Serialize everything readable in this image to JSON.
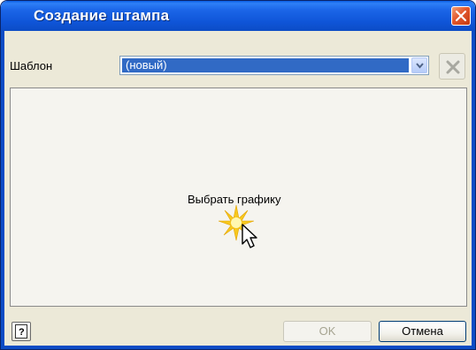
{
  "window": {
    "title": "Создание штампа",
    "close_icon": "close-icon"
  },
  "template": {
    "label": "Шаблон",
    "selected": "(новый)",
    "dropdown_icon": "chevron-down-icon",
    "delete_icon": "delete-x-icon"
  },
  "preview": {
    "prompt": "Выбрать графику",
    "cursor_icon": "pointer-click-icon"
  },
  "buttons": {
    "help_icon": "help-icon",
    "ok_label": "OK",
    "cancel_label": "Отмена"
  },
  "colors": {
    "titlebar": "#0c4cc5",
    "selection": "#316ac5",
    "close": "#e2572c",
    "dialog_bg": "#ece9d8"
  }
}
